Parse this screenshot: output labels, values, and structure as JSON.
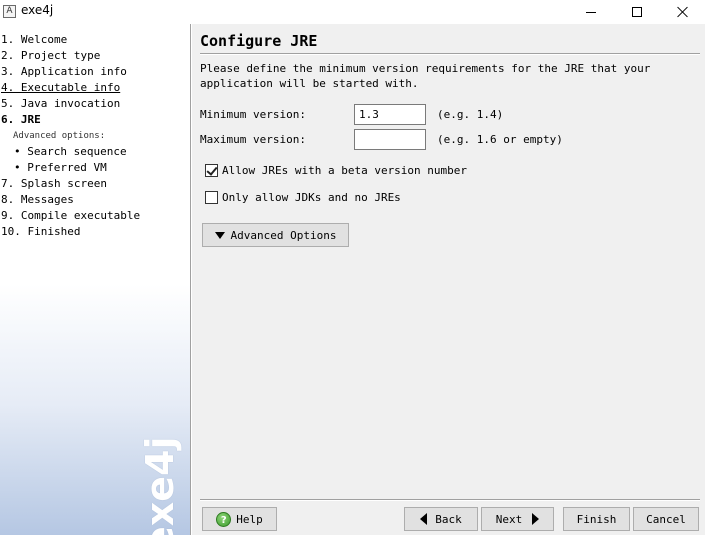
{
  "window": {
    "title": "exe4j",
    "icon": "exe4j-app-icon",
    "icon_glyph": "A"
  },
  "sidebar": {
    "steps": [
      {
        "label": "1. Welcome",
        "state": "normal"
      },
      {
        "label": "2. Project type",
        "state": "normal"
      },
      {
        "label": "3. Application info",
        "state": "normal"
      },
      {
        "label": "4. Executable info",
        "state": "visited"
      },
      {
        "label": "5. Java invocation",
        "state": "normal"
      },
      {
        "label": "6. JRE",
        "state": "current"
      }
    ],
    "advanced_header": "Advanced options:",
    "sub_steps": [
      {
        "label": "• Search sequence"
      },
      {
        "label": "• Preferred VM"
      }
    ],
    "steps_after": [
      {
        "label": "7. Splash screen"
      },
      {
        "label": "8. Messages"
      },
      {
        "label": "9. Compile executable"
      },
      {
        "label": "10. Finished"
      }
    ],
    "watermark": "exe4j"
  },
  "main": {
    "title": "Configure JRE",
    "description": "Please define the minimum version requirements for the JRE that your application will be started with.",
    "min_version": {
      "label": "Minimum version:",
      "value": "1.3",
      "hint": "(e.g. 1.4)"
    },
    "max_version": {
      "label": "Maximum version:",
      "value": "",
      "hint": "(e.g. 1.6 or empty)"
    },
    "allow_beta": {
      "label": "Allow JREs with a beta version number",
      "checked": true
    },
    "only_jdks": {
      "label": "Only allow JDKs and no JREs",
      "checked": false
    },
    "advanced_button": "Advanced Options"
  },
  "footer": {
    "help": "Help",
    "back": "Back",
    "next": "Next",
    "finish": "Finish",
    "cancel": "Cancel"
  },
  "colors": {
    "content_bg": "#f0f0f0",
    "button_bg": "#e1e1e1",
    "sidebar_gradient_end": "#b5c7e3"
  }
}
